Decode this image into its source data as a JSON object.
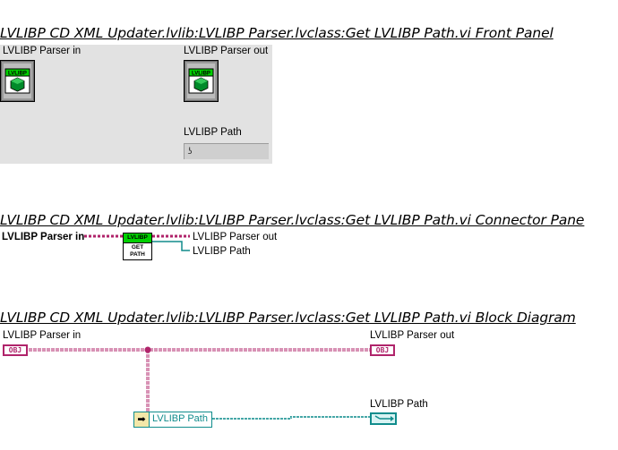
{
  "front_panel": {
    "heading": "LVLIBP CD XML Updater.lvlib:LVLIBP Parser.lvclass:Get LVLIBP Path.vi Front Panel",
    "parser_in_label": "LVLIBP Parser in",
    "parser_out_label": "LVLIBP Parser out",
    "path_label": "LVLIBP Path",
    "class_tag": "LVLIBP",
    "path_value": ""
  },
  "connector_pane": {
    "heading": "LVLIBP CD XML Updater.lvlib:LVLIBP Parser.lvclass:Get LVLIBP Path.vi Connector Pane",
    "input_label": "LVLIBP Parser in",
    "output_parser_label": "LVLIBP Parser out",
    "output_path_label": "LVLIBP Path",
    "icon_top": "LVLIBP",
    "icon_line1": "GET",
    "icon_line2": "PATH"
  },
  "block_diagram": {
    "heading": "LVLIBP CD XML Updater.lvlib:LVLIBP Parser.lvclass:Get LVLIBP Path.vi Block Diagram",
    "parser_in_label": "LVLIBP Parser in",
    "parser_out_label": "LVLIBP Parser out",
    "path_label": "LVLIBP Path",
    "obj_tag": "OBJ",
    "unbundle_label": "LVLIBP Path"
  },
  "colors": {
    "class_wire": "#b0246b",
    "path_wire": "#108c8c",
    "panel_bg": "#e2e2e2",
    "class_green": "#00d000"
  }
}
